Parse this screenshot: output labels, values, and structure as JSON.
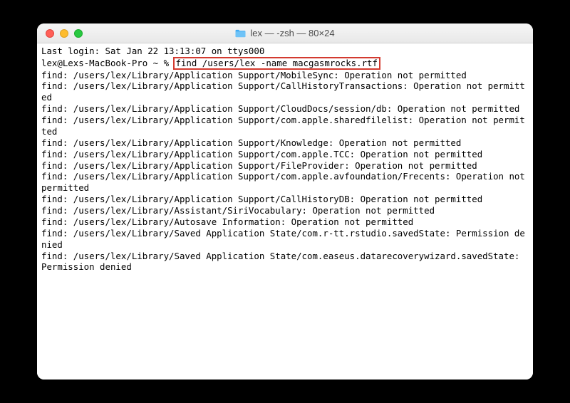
{
  "window": {
    "title": "lex — -zsh — 80×24"
  },
  "terminal": {
    "last_login": "Last login: Sat Jan 22 13:13:07 on ttys000",
    "prompt": "lex@Lexs-MacBook-Pro ~ % ",
    "command": "find /users/lex -name macgasmrocks.rtf",
    "output": "find: /users/lex/Library/Application Support/MobileSync: Operation not permitted\nfind: /users/lex/Library/Application Support/CallHistoryTransactions: Operation not permitted\nfind: /users/lex/Library/Application Support/CloudDocs/session/db: Operation not permitted\nfind: /users/lex/Library/Application Support/com.apple.sharedfilelist: Operation not permitted\nfind: /users/lex/Library/Application Support/Knowledge: Operation not permitted\nfind: /users/lex/Library/Application Support/com.apple.TCC: Operation not permitted\nfind: /users/lex/Library/Application Support/FileProvider: Operation not permitted\nfind: /users/lex/Library/Application Support/com.apple.avfoundation/Frecents: Operation not permitted\nfind: /users/lex/Library/Application Support/CallHistoryDB: Operation not permitted\nfind: /users/lex/Library/Assistant/SiriVocabulary: Operation not permitted\nfind: /users/lex/Library/Autosave Information: Operation not permitted\nfind: /users/lex/Library/Saved Application State/com.r-tt.rstudio.savedState: Permission denied\nfind: /users/lex/Library/Saved Application State/com.easeus.datarecoverywizard.savedState: Permission denied"
  }
}
